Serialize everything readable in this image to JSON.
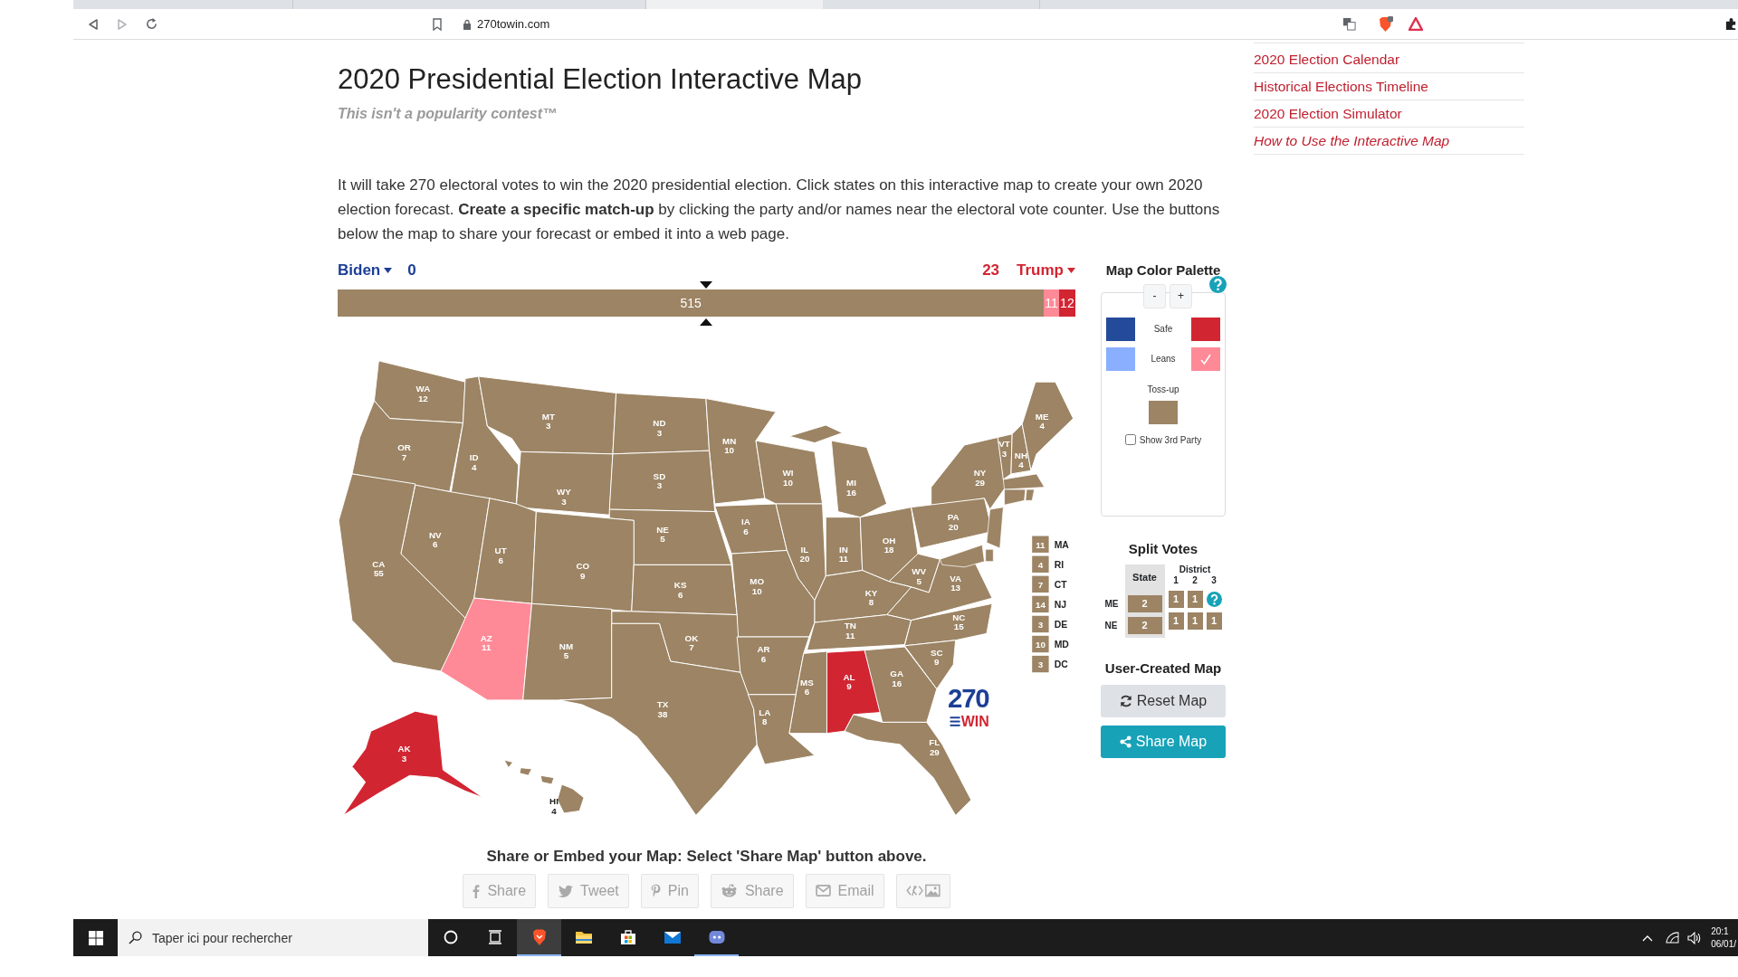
{
  "browser": {
    "url": "270towin.com"
  },
  "header": {
    "title": "2020 Presidential Election Interactive Map",
    "tagline": "This isn't a popularity contest™"
  },
  "intro": "It will take 270 electoral votes to win the 2020 presidential election. Click states on this interactive map to create your own 2020 election forecast. **Create a specific match-up** by clicking the party and/or names near the electoral vote counter. Use the buttons below the map to share your forecast or embed it into a web page.",
  "sidebar_links": [
    {
      "label": "2020 Election Calendar",
      "kind": "link"
    },
    {
      "label": "Historical Elections Timeline",
      "kind": "link"
    },
    {
      "label": "2020 Election Simulator",
      "kind": "link"
    },
    {
      "label": "How to Use the Interactive Map",
      "kind": "guide"
    }
  ],
  "counter": {
    "left": {
      "name": "Biden",
      "votes": "0"
    },
    "right": {
      "name": "Trump",
      "votes": "23"
    }
  },
  "bar": [
    {
      "color": "#9c8464",
      "value": "515"
    },
    {
      "color": "#ff8a97",
      "value": "11"
    },
    {
      "color": "#d22532",
      "value": "12"
    }
  ],
  "states": [
    {
      "abbr": "WA",
      "votes": "12",
      "color": "#9c8464"
    },
    {
      "abbr": "OR",
      "votes": "7",
      "color": "#9c8464"
    },
    {
      "abbr": "ID",
      "votes": "4",
      "color": "#9c8464"
    },
    {
      "abbr": "MT",
      "votes": "3",
      "color": "#9c8464"
    },
    {
      "abbr": "ND",
      "votes": "3",
      "color": "#9c8464"
    },
    {
      "abbr": "MN",
      "votes": "10",
      "color": "#9c8464"
    },
    {
      "abbr": "WI",
      "votes": "10",
      "color": "#9c8464"
    },
    {
      "abbr": "MI",
      "votes": "16",
      "color": "#9c8464"
    },
    {
      "abbr": "NY",
      "votes": "29",
      "color": "#9c8464"
    },
    {
      "abbr": "VT",
      "votes": "3",
      "color": "#9c8464"
    },
    {
      "abbr": "NH",
      "votes": "4",
      "color": "#9c8464"
    },
    {
      "abbr": "ME",
      "votes": "4",
      "color": "#9c8464"
    },
    {
      "abbr": "WY",
      "votes": "3",
      "color": "#9c8464"
    },
    {
      "abbr": "SD",
      "votes": "3",
      "color": "#9c8464"
    },
    {
      "abbr": "IA",
      "votes": "6",
      "color": "#9c8464"
    },
    {
      "abbr": "NE",
      "votes": "5",
      "color": "#9c8464"
    },
    {
      "abbr": "NV",
      "votes": "6",
      "color": "#9c8464"
    },
    {
      "abbr": "UT",
      "votes": "6",
      "color": "#9c8464"
    },
    {
      "abbr": "CO",
      "votes": "9",
      "color": "#9c8464"
    },
    {
      "abbr": "CA",
      "votes": "55",
      "color": "#9c8464"
    },
    {
      "abbr": "IL",
      "votes": "20",
      "color": "#9c8464"
    },
    {
      "abbr": "IN",
      "votes": "11",
      "color": "#9c8464"
    },
    {
      "abbr": "OH",
      "votes": "18",
      "color": "#9c8464"
    },
    {
      "abbr": "PA",
      "votes": "20",
      "color": "#9c8464"
    },
    {
      "abbr": "WV",
      "votes": "5",
      "color": "#9c8464"
    },
    {
      "abbr": "VA",
      "votes": "13",
      "color": "#9c8464"
    },
    {
      "abbr": "KS",
      "votes": "6",
      "color": "#9c8464"
    },
    {
      "abbr": "MO",
      "votes": "10",
      "color": "#9c8464"
    },
    {
      "abbr": "KY",
      "votes": "8",
      "color": "#9c8464"
    },
    {
      "abbr": "TN",
      "votes": "11",
      "color": "#9c8464"
    },
    {
      "abbr": "NC",
      "votes": "15",
      "color": "#9c8464"
    },
    {
      "abbr": "OK",
      "votes": "7",
      "color": "#9c8464"
    },
    {
      "abbr": "AR",
      "votes": "6",
      "color": "#9c8464"
    },
    {
      "abbr": "SC",
      "votes": "9",
      "color": "#9c8464"
    },
    {
      "abbr": "AZ",
      "votes": "11",
      "color": "#ff8a97"
    },
    {
      "abbr": "NM",
      "votes": "5",
      "color": "#9c8464"
    },
    {
      "abbr": "MS",
      "votes": "6",
      "color": "#9c8464"
    },
    {
      "abbr": "AL",
      "votes": "9",
      "color": "#d22532"
    },
    {
      "abbr": "GA",
      "votes": "16",
      "color": "#9c8464"
    },
    {
      "abbr": "TX",
      "votes": "38",
      "color": "#9c8464"
    },
    {
      "abbr": "LA",
      "votes": "8",
      "color": "#9c8464"
    },
    {
      "abbr": "FL",
      "votes": "29",
      "color": "#9c8464"
    },
    {
      "abbr": "AK",
      "votes": "3",
      "color": "#d22532"
    },
    {
      "abbr": "HI",
      "votes": "4",
      "color": "#9c8464"
    }
  ],
  "small_states": [
    {
      "abbr": "MA",
      "votes": "11",
      "color": "#9c8464"
    },
    {
      "abbr": "RI",
      "votes": "4",
      "color": "#9c8464"
    },
    {
      "abbr": "CT",
      "votes": "7",
      "color": "#9c8464"
    },
    {
      "abbr": "NJ",
      "votes": "14",
      "color": "#9c8464"
    },
    {
      "abbr": "DE",
      "votes": "3",
      "color": "#9c8464"
    },
    {
      "abbr": "MD",
      "votes": "10",
      "color": "#9c8464"
    },
    {
      "abbr": "DC",
      "votes": "3",
      "color": "#9c8464"
    }
  ],
  "logo": {
    "number": "270",
    "word": "WIN"
  },
  "palette": {
    "title": "Map Color Palette",
    "buttons": [
      "-",
      "+"
    ],
    "rows": [
      {
        "label": "Safe",
        "left": {
          "color": "#244a9a",
          "selected": false
        },
        "right": {
          "color": "#d22532",
          "selected": false
        }
      },
      {
        "label": "Leans",
        "left": {
          "color": "#8aaffe",
          "selected": false
        },
        "right": {
          "color": "#ff8a97",
          "selected": true
        }
      }
    ],
    "tossup": {
      "label": "Toss-up",
      "color": "#9c8464",
      "selected": false
    },
    "third_party": {
      "label": "Show 3rd Party",
      "checked": false
    }
  },
  "split_votes": {
    "title": "Split Votes",
    "state_header": "State",
    "district_header": "District",
    "district_numbers": [
      "1",
      "2",
      "3"
    ],
    "rows": [
      {
        "state": "ME",
        "state_votes": "2",
        "districts": [
          "1",
          "1"
        ],
        "help": true
      },
      {
        "state": "NE",
        "state_votes": "2",
        "districts": [
          "1",
          "1",
          "1"
        ],
        "help": false
      }
    ]
  },
  "user_map": {
    "title": "User-Created Map",
    "buttons": [
      {
        "kind": "reset",
        "label": "Reset Map"
      },
      {
        "kind": "share",
        "label": "Share Map"
      }
    ]
  },
  "share": {
    "heading": "Share or Embed your Map: Select 'Share Map' button above.",
    "buttons": [
      {
        "kind": "facebook",
        "label": "Share"
      },
      {
        "kind": "twitter",
        "label": "Tweet"
      },
      {
        "kind": "pinterest",
        "label": "Pin"
      },
      {
        "kind": "reddit",
        "label": "Share"
      },
      {
        "kind": "email",
        "label": "Email"
      },
      {
        "kind": "embed"
      }
    ]
  },
  "taskbar": {
    "search_placeholder": "Taper ici pour rechercher",
    "apps": [
      {
        "kind": "cortana",
        "selected": false,
        "running": false
      },
      {
        "kind": "taskview",
        "selected": false,
        "running": false
      },
      {
        "kind": "brave",
        "selected": true,
        "running": true
      },
      {
        "kind": "folder",
        "selected": false,
        "running": false
      },
      {
        "kind": "store",
        "selected": false,
        "running": false
      },
      {
        "kind": "mail",
        "selected": false,
        "running": false
      },
      {
        "kind": "discord",
        "selected": false,
        "running": true
      }
    ],
    "time": "20:1",
    "date": "06/01/"
  }
}
